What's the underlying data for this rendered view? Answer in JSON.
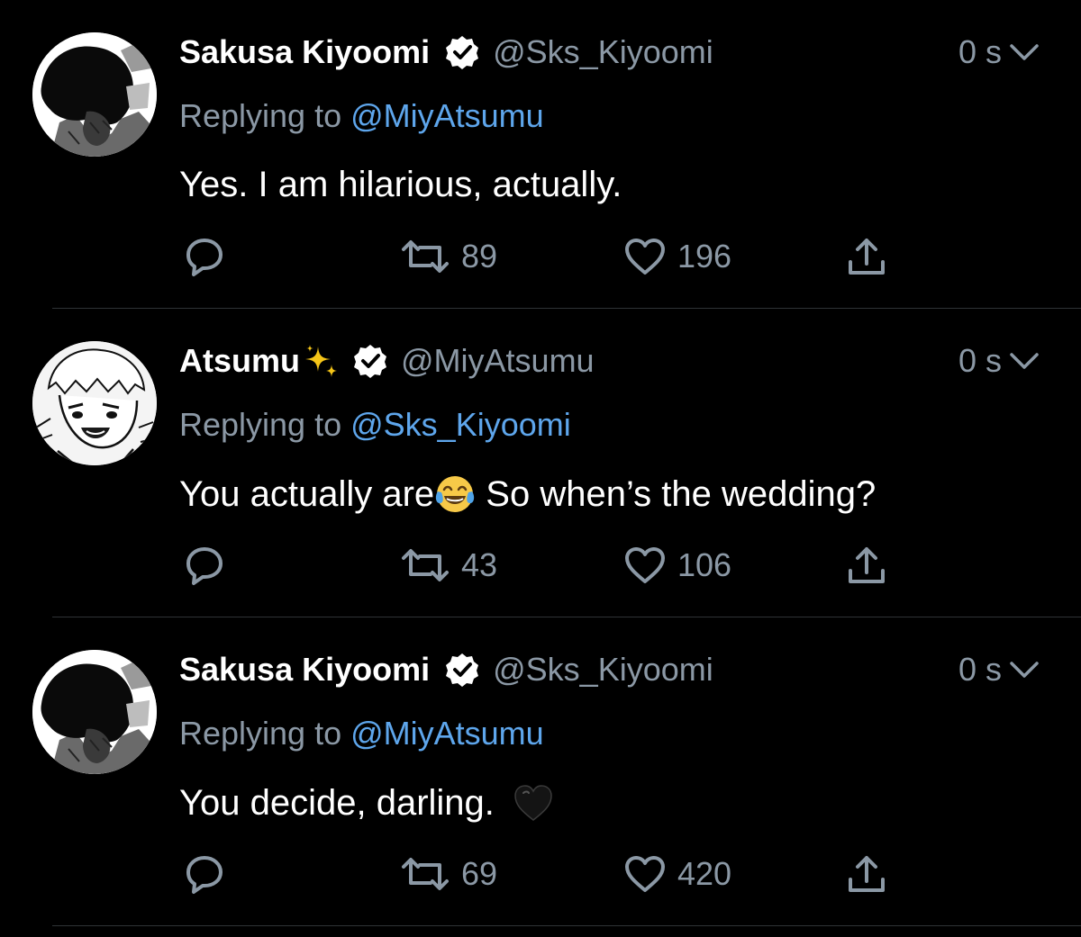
{
  "colors": {
    "background": "#000000",
    "primary_text": "#ffffff",
    "secondary_text": "#8b98a5",
    "link": "#5ea6ec",
    "divider": "#2f3336"
  },
  "tweets": [
    {
      "display_name": "Sakusa Kiyoomi",
      "verified": true,
      "handle": "@Sks_Kiyoomi",
      "timestamp": "0 s",
      "replying_prefix": "Replying to",
      "replying_to": "@MiyAtsumu",
      "text": "Yes. I am hilarious, actually.",
      "text_after_emoji": "",
      "emoji": "",
      "retweets": "89",
      "likes": "196",
      "avatar": "sakusa-manga-avatar",
      "name_emoji": ""
    },
    {
      "display_name": "Atsumu",
      "verified": true,
      "handle": "@MiyAtsumu",
      "timestamp": "0 s",
      "replying_prefix": "Replying to",
      "replying_to": "@Sks_Kiyoomi",
      "text": "You actually are",
      "emoji": "face-with-tears-of-joy",
      "text_after_emoji": " So when’s the wedding?",
      "retweets": "43",
      "likes": "106",
      "avatar": "atsumu-manga-avatar",
      "name_emoji": "sparkles"
    },
    {
      "display_name": "Sakusa Kiyoomi",
      "verified": true,
      "handle": "@Sks_Kiyoomi",
      "timestamp": "0 s",
      "replying_prefix": "Replying to",
      "replying_to": "@MiyAtsumu",
      "text": "You decide, darling.",
      "emoji": "black-heart",
      "text_after_emoji": "",
      "retweets": "69",
      "likes": "420",
      "avatar": "sakusa-manga-avatar",
      "name_emoji": ""
    }
  ]
}
